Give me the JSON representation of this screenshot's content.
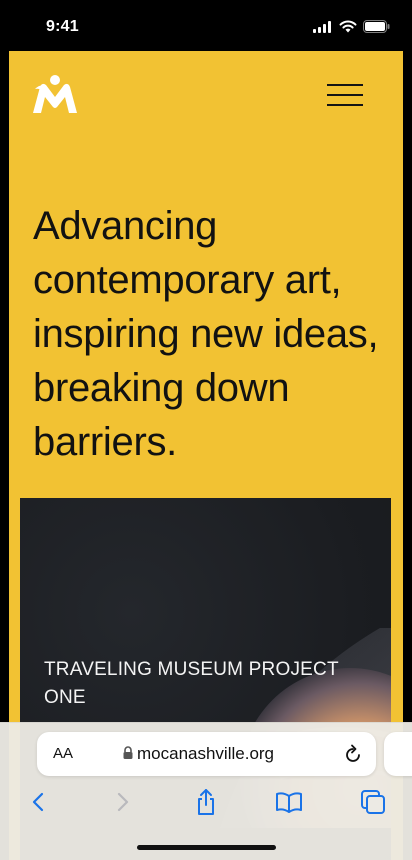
{
  "status_bar": {
    "time": "9:41",
    "icons": [
      "signal-icon",
      "wifi-icon",
      "battery-icon"
    ]
  },
  "site": {
    "background_color": "#f2c233",
    "logo": "moca-logo",
    "menu_icon": "hamburger-menu-icon",
    "headline": "Advancing contemporary art, inspiring new ideas, breaking down barriers.",
    "feature": {
      "title": "TRAVELING MUSEUM PROJECT ONE"
    }
  },
  "browser": {
    "text_size_label": "AA",
    "url": "mocanashville.org",
    "accent_color": "#1a73e8",
    "toolbar": [
      "back-icon",
      "forward-icon",
      "share-icon",
      "bookmarks-icon",
      "tabs-icon"
    ]
  }
}
